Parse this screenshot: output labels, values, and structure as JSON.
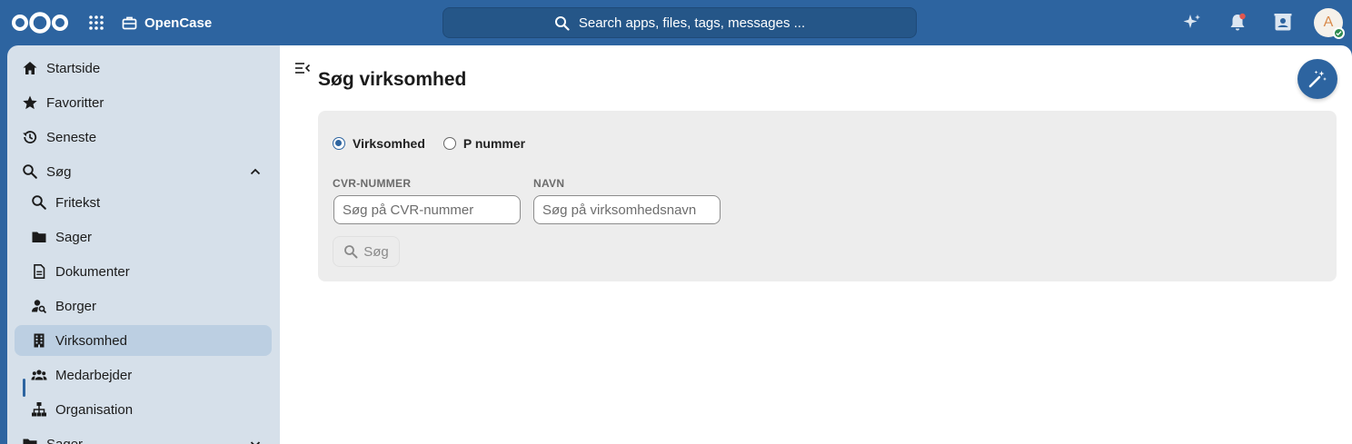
{
  "header": {
    "app_name": "OpenCase",
    "search_placeholder": "Search apps, files, tags, messages ...",
    "avatar_initial": "A",
    "colors": {
      "bar": "#2d64a0",
      "notification_dot": "#e0574f",
      "status_online": "#2d8a4e"
    }
  },
  "sidebar": {
    "items": [
      {
        "label": "Startside",
        "icon": "home-icon"
      },
      {
        "label": "Favoritter",
        "icon": "star-icon"
      },
      {
        "label": "Seneste",
        "icon": "history-icon"
      },
      {
        "label": "Søg",
        "icon": "search-icon",
        "expanded": true
      },
      {
        "label": "Fritekst",
        "icon": "search-icon"
      },
      {
        "label": "Sager",
        "icon": "folder-icon"
      },
      {
        "label": "Dokumenter",
        "icon": "document-icon"
      },
      {
        "label": "Borger",
        "icon": "person-search-icon"
      },
      {
        "label": "Virksomhed",
        "icon": "building-icon",
        "active": true
      },
      {
        "label": "Medarbejder",
        "icon": "group-icon"
      },
      {
        "label": "Organisation",
        "icon": "org-chart-icon"
      },
      {
        "label": "Sager",
        "icon": "folder-icon",
        "expanded": false
      }
    ]
  },
  "main": {
    "title": "Søg virksomhed",
    "radios": [
      {
        "label": "Virksomhed",
        "checked": true
      },
      {
        "label": "P nummer",
        "checked": false
      }
    ],
    "fields": {
      "cvr_label": "CVR-NUMMER",
      "cvr_placeholder": "Søg på CVR-nummer",
      "cvr_value": "",
      "name_label": "NAVN",
      "name_placeholder": "Søg på virksomhedsnavn",
      "name_value": ""
    },
    "search_button": "Søg"
  }
}
